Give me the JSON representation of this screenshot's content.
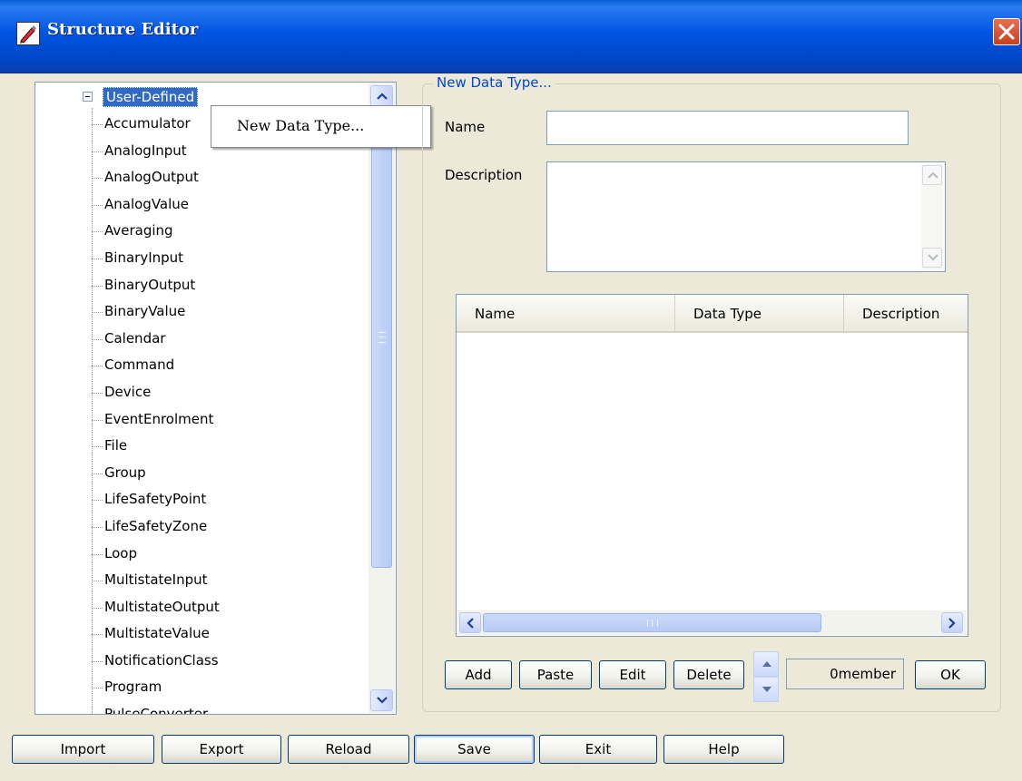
{
  "window": {
    "title": "Structure Editor"
  },
  "tree": {
    "root_label": "User-Defined",
    "items": [
      "Accumulator",
      "AnalogInput",
      "AnalogOutput",
      "AnalogValue",
      "Averaging",
      "BinaryInput",
      "BinaryOutput",
      "BinaryValue",
      "Calendar",
      "Command",
      "Device",
      "EventEnrolment",
      "File",
      "Group",
      "LifeSafetyPoint",
      "LifeSafetyZone",
      "Loop",
      "MultistateInput",
      "MultistateOutput",
      "MultistateValue",
      "NotificationClass",
      "Program",
      "PulseConverter"
    ]
  },
  "context_menu": {
    "items": [
      "New Data Type..."
    ]
  },
  "form": {
    "group_title": "New Data Type...",
    "name_label": "Name",
    "name_value": "",
    "description_label": "Description",
    "description_value": ""
  },
  "members_table": {
    "columns": [
      "Name",
      "Data Type",
      "Description"
    ],
    "rows": []
  },
  "member_buttons": {
    "add": "Add",
    "paste": "Paste",
    "edit": "Edit",
    "delete": "Delete",
    "ok": "OK"
  },
  "member_count": "0member",
  "bottom_buttons": {
    "import": "Import",
    "export": "Export",
    "reload": "Reload",
    "save": "Save",
    "exit": "Exit",
    "help": "Help"
  },
  "colors": {
    "titlebar": "#0054e3",
    "selection": "#316ac5",
    "group_title": "#0046d5",
    "close": "#d2452a"
  }
}
